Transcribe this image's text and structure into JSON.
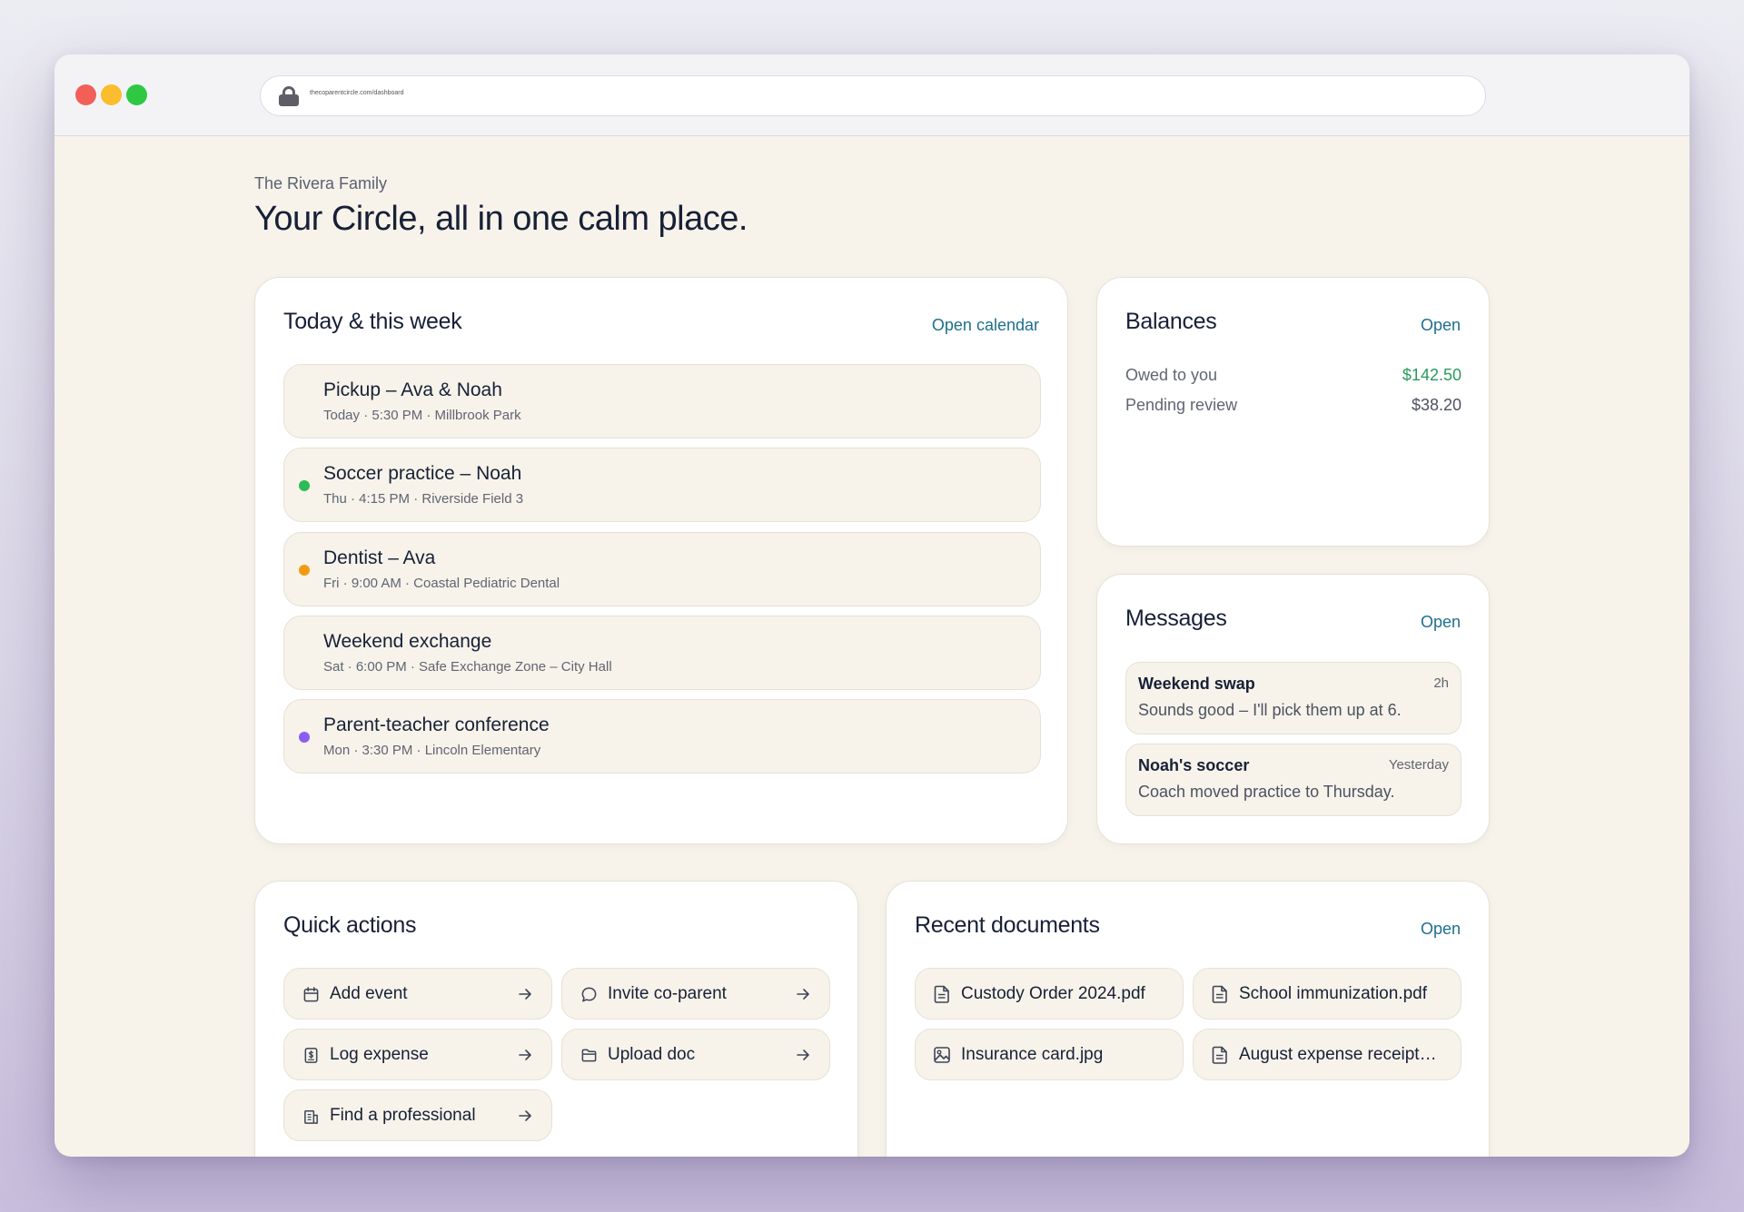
{
  "browser": {
    "url": "thecoparentcircle.com/dashboard"
  },
  "header": {
    "family_name": "The Rivera Family",
    "headline": "Your Circle, all in one calm place."
  },
  "schedule": {
    "title": "Today & this week",
    "link": "Open calendar",
    "events": [
      {
        "title": "Pickup – Ava & Noah",
        "subtitle": "Today · 5:30 PM · Millbrook Park",
        "dot_color": ""
      },
      {
        "title": "Soccer practice – Noah",
        "subtitle": "Thu · 4:15 PM · Riverside Field 3",
        "dot_color": "#2dbb55"
      },
      {
        "title": "Dentist – Ava",
        "subtitle": "Fri · 9:00 AM · Coastal Pediatric Dental",
        "dot_color": "#f29a12"
      },
      {
        "title": "Weekend exchange",
        "subtitle": "Sat · 6:00 PM · Safe Exchange Zone – City Hall",
        "dot_color": ""
      },
      {
        "title": "Parent-teacher conference",
        "subtitle": "Mon · 3:30 PM · Lincoln Elementary",
        "dot_color": "#8b5cf6"
      }
    ]
  },
  "balances": {
    "title": "Balances",
    "link": "Open",
    "rows": [
      {
        "label": "Owed to you",
        "value": "$142.50",
        "color": "#2a9a5a"
      },
      {
        "label": "Pending review",
        "value": "$38.20",
        "color": "#4c5262"
      }
    ]
  },
  "messages": {
    "title": "Messages",
    "link": "Open",
    "items": [
      {
        "title": "Weekend swap",
        "time": "2h",
        "body": "Sounds good – I'll pick them up at 6."
      },
      {
        "title": "Noah's soccer",
        "time": "Yesterday",
        "body": "Coach moved practice to Thursday."
      }
    ]
  },
  "quick_actions": {
    "title": "Quick actions",
    "items": [
      {
        "label": "Add event",
        "icon": "calendar-icon"
      },
      {
        "label": "Invite co-parent",
        "icon": "chat-bubble-icon"
      },
      {
        "label": "Log expense",
        "icon": "receipt-dollar-icon"
      },
      {
        "label": "Upload doc",
        "icon": "folder-icon"
      },
      {
        "label": "Find a professional",
        "icon": "building-icon"
      }
    ]
  },
  "documents": {
    "title": "Recent documents",
    "link": "Open",
    "items": [
      {
        "name": "Custody Order 2024.pdf",
        "icon": "file-text-icon"
      },
      {
        "name": "School immunization.pdf",
        "icon": "file-text-icon"
      },
      {
        "name": "Insurance card.jpg",
        "icon": "image-icon"
      },
      {
        "name": "August expense receipt…",
        "icon": "file-text-icon"
      }
    ]
  }
}
